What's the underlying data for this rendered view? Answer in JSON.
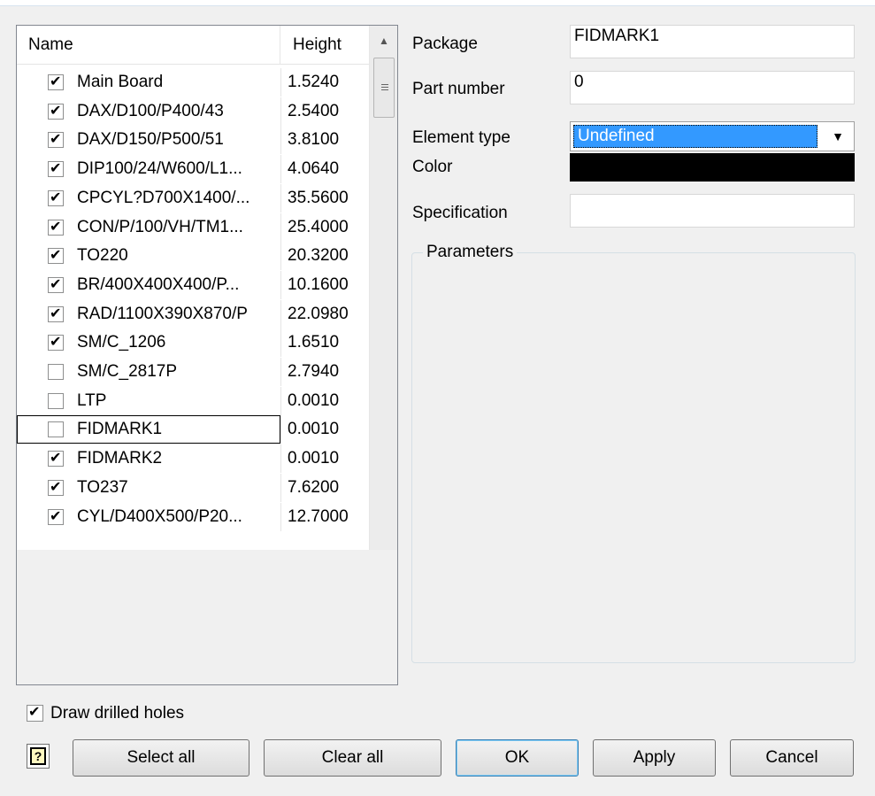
{
  "list": {
    "col_name": "Name",
    "col_height": "Height",
    "rows": [
      {
        "name": "Main Board",
        "height": "1.5240",
        "checked": true
      },
      {
        "name": "DAX/D100/P400/43",
        "height": "2.5400",
        "checked": true
      },
      {
        "name": "DAX/D150/P500/51",
        "height": "3.8100",
        "checked": true
      },
      {
        "name": "DIP100/24/W600/L1...",
        "height": "4.0640",
        "checked": true
      },
      {
        "name": "CPCYL?D700X1400/...",
        "height": "35.5600",
        "checked": true
      },
      {
        "name": "CON/P/100/VH/TM1...",
        "height": "25.4000",
        "checked": true
      },
      {
        "name": "TO220",
        "height": "20.3200",
        "checked": true
      },
      {
        "name": "BR/400X400X400/P...",
        "height": "10.1600",
        "checked": true
      },
      {
        "name": "RAD/1100X390X870/P",
        "height": "22.0980",
        "checked": true
      },
      {
        "name": "SM/C_1206",
        "height": "1.6510",
        "checked": true
      },
      {
        "name": "SM/C_2817P",
        "height": "2.7940",
        "checked": false
      },
      {
        "name": "LTP",
        "height": "0.0010",
        "checked": false
      },
      {
        "name": "FIDMARK1",
        "height": "0.0010",
        "checked": false,
        "selected": true
      },
      {
        "name": "FIDMARK2",
        "height": "0.0010",
        "checked": true
      },
      {
        "name": "TO237",
        "height": "7.6200",
        "checked": true
      },
      {
        "name": "CYL/D400X500/P20...",
        "height": "12.7000",
        "checked": true
      }
    ]
  },
  "props": {
    "package_label": "Package",
    "package_value": "FIDMARK1",
    "part_number_label": "Part number",
    "part_number_value": "0",
    "element_type_label": "Element type",
    "element_type_value": "Undefined",
    "color_label": "Color",
    "color_value": "#000000",
    "specification_label": "Specification",
    "specification_value": "",
    "parameters_label": "Parameters"
  },
  "options": {
    "draw_drilled_holes_label": "Draw drilled holes",
    "draw_drilled_holes_checked": true
  },
  "buttons": {
    "help": "?",
    "select_all": "Select all",
    "clear_all": "Clear all",
    "ok": "OK",
    "apply": "Apply",
    "cancel": "Cancel"
  }
}
